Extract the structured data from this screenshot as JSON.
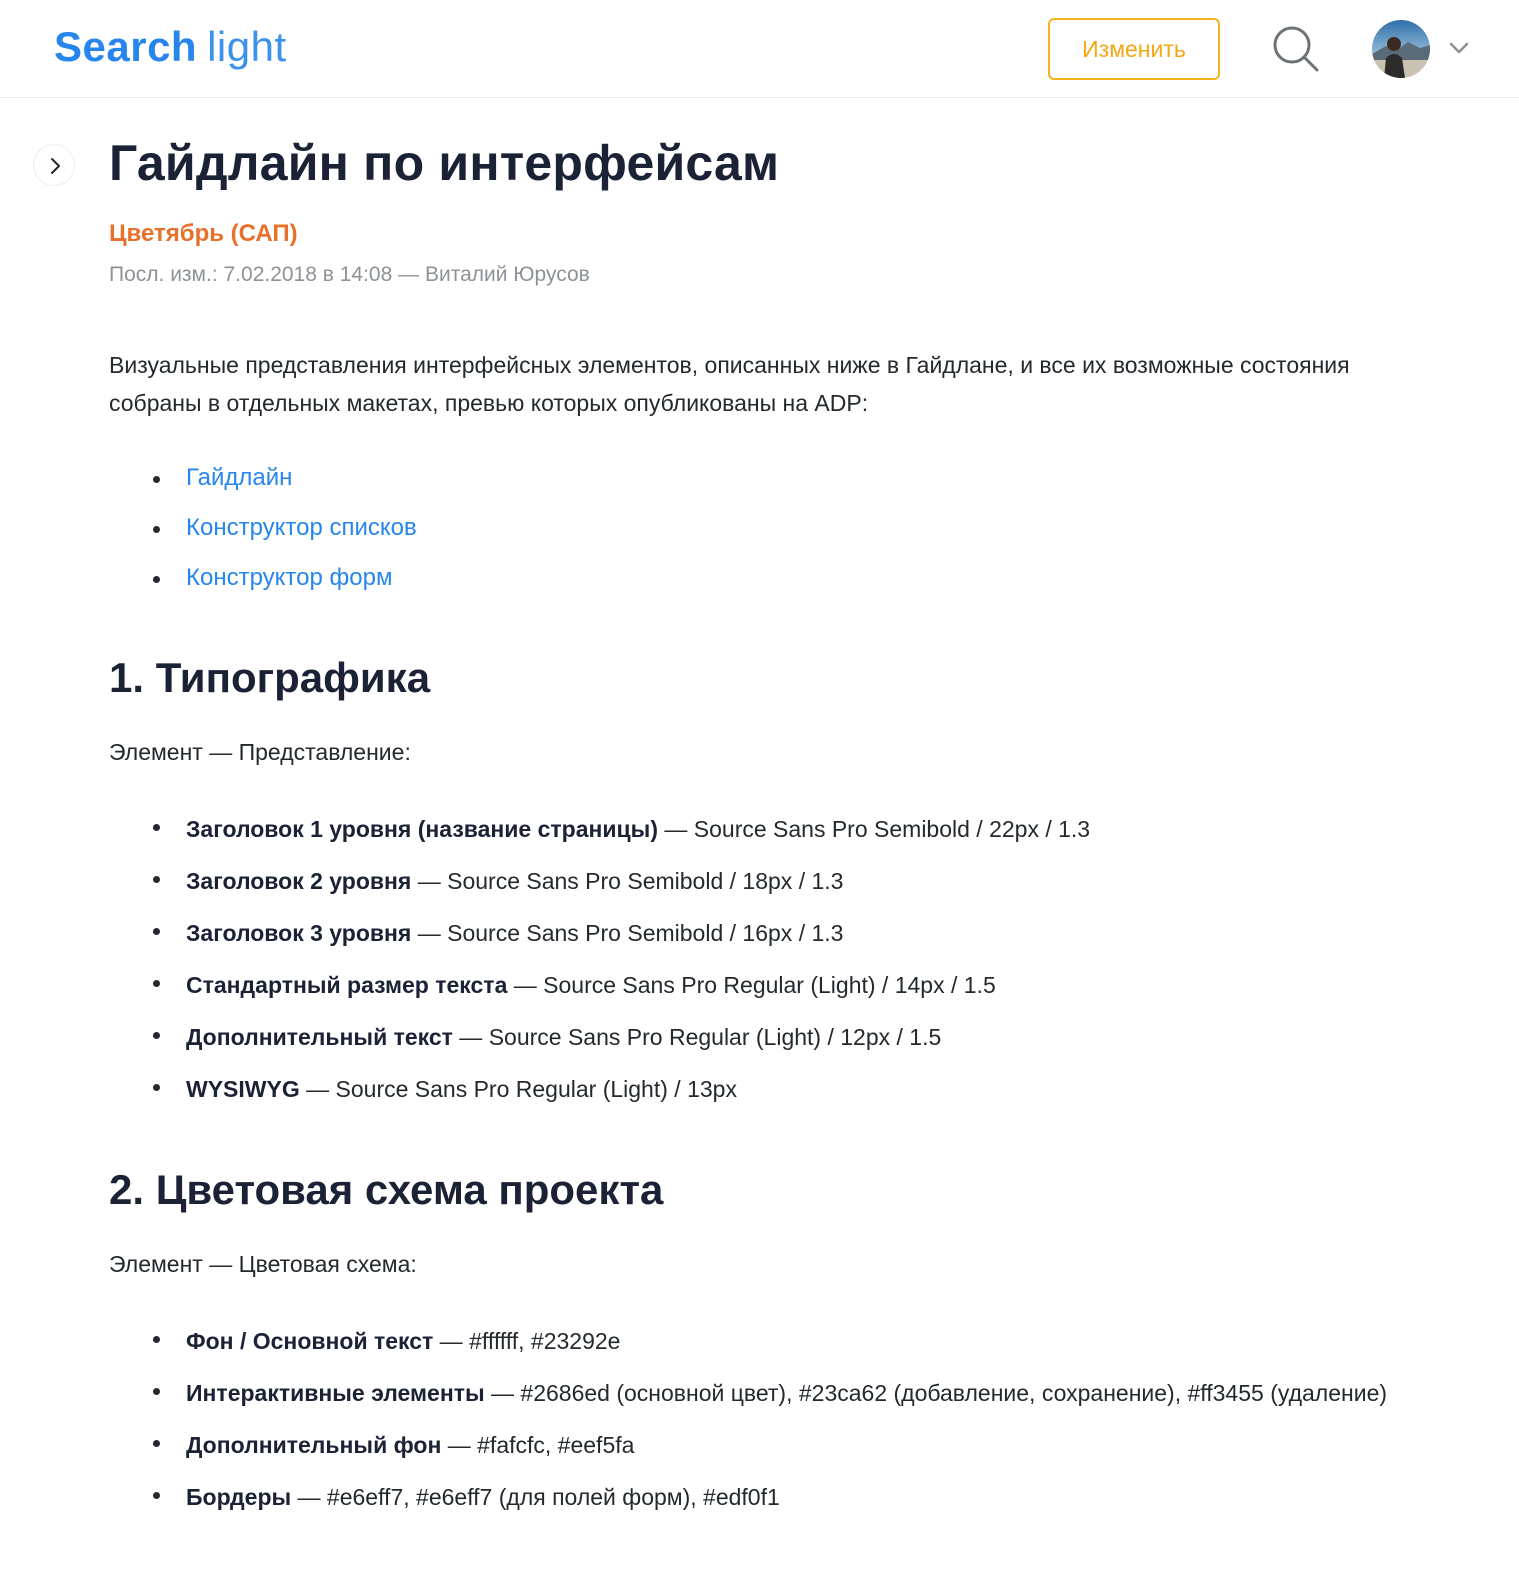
{
  "header": {
    "logo_bold": "Search",
    "logo_light": "light",
    "edit_button_label": "Изменить"
  },
  "icons": {
    "search": "search-icon",
    "avatar": "avatar",
    "chevron": "chevron-down-icon",
    "sidebar_toggle": "chevron-right-icon"
  },
  "colors": {
    "accent": "#2686ed",
    "edit_button": "#f3b321",
    "space_name": "#e8702a",
    "text": "#23292e"
  },
  "page": {
    "title": "Гайдлайн по интерфейсам",
    "space_name": "Цветябрь (САП)",
    "meta": "Посл. изм.: 7.02.2018 в 14:08 — Виталий Юрусов",
    "intro": "Визуальные представления интерфейсных элементов, описанных ниже в Гайдлане, и все их возможные состояния собраны в отдельных макетах, превью которых опубликованы на ADP:",
    "links": [
      "Гайдлайн",
      "Конструктор списков",
      "Конструктор форм"
    ]
  },
  "sections": [
    {
      "title": "1. Типографика",
      "lead": "Элемент — Представление:",
      "items": [
        {
          "term": "Заголовок 1 уровня (название страницы)",
          "desc": " — Source Sans Pro Semibold / 22px / 1.3"
        },
        {
          "term": "Заголовок 2 уровня",
          "desc": " — Source Sans Pro Semibold / 18px / 1.3"
        },
        {
          "term": "Заголовок 3 уровня",
          "desc": " — Source Sans Pro Semibold / 16px / 1.3"
        },
        {
          "term": "Стандартный размер текста",
          "desc": " — Source Sans Pro Regular (Light) / 14px / 1.5"
        },
        {
          "term": "Дополнительный текст",
          "desc": " — Source Sans Pro Regular (Light) / 12px / 1.5"
        },
        {
          "term": "WYSIWYG",
          "desc": " — Source Sans Pro Regular (Light) / 13px"
        }
      ]
    },
    {
      "title": "2. Цветовая схема проекта",
      "lead": "Элемент — Цветовая схема:",
      "items": [
        {
          "term": "Фон / Основной текст",
          "desc": " — #ffffff, #23292e"
        },
        {
          "term": "Интерактивные элементы",
          "desc": " — #2686ed (основной цвет), #23ca62 (добавление, сохранение), #ff3455 (удаление)"
        },
        {
          "term": "Дополнительный фон",
          "desc": " — #fafcfc, #eef5fa"
        },
        {
          "term": "Бордеры",
          "desc": " — #e6eff7, #e6eff7 (для полей форм), #edf0f1"
        }
      ]
    }
  ]
}
